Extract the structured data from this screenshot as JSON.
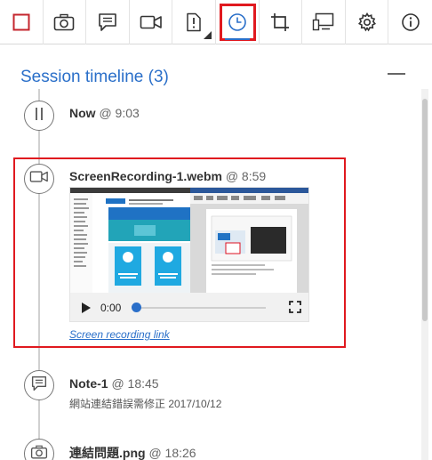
{
  "toolbar": {
    "buttons": [
      {
        "icon": "stop-icon"
      },
      {
        "icon": "camera-icon"
      },
      {
        "icon": "note-icon"
      },
      {
        "icon": "video-camera-icon"
      },
      {
        "icon": "report-issue-icon"
      },
      {
        "icon": "clock-icon",
        "active": true
      },
      {
        "icon": "crop-icon"
      },
      {
        "icon": "devices-icon"
      },
      {
        "icon": "settings-icon"
      },
      {
        "icon": "info-icon"
      }
    ],
    "accent": "#2a6fc9",
    "highlight": "#e0191f"
  },
  "panel": {
    "title": "Session timeline (3)"
  },
  "timeline": {
    "items": [
      {
        "icon": "pause-icon",
        "name": "Now",
        "time": "@ 9:03"
      },
      {
        "icon": "video-camera-icon",
        "name": "ScreenRecording-1.webm",
        "time": "@ 8:59",
        "player": {
          "current_time": "0:00",
          "progress": 0
        },
        "link": "Screen recording link"
      },
      {
        "icon": "note-icon",
        "name": "Note-1",
        "time": "@ 18:45",
        "text": "網站連結錯誤需修正 2017/10/12"
      },
      {
        "icon": "camera-icon",
        "name": "連結問題.png",
        "time": "@ 18:26"
      }
    ]
  }
}
